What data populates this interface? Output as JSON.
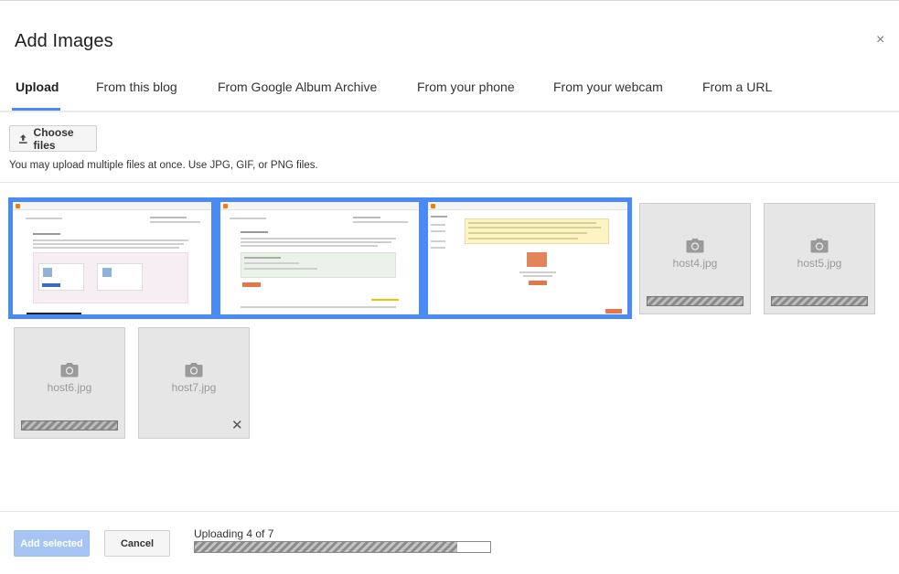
{
  "dialog": {
    "title": "Add Images",
    "close_glyph": "×"
  },
  "tabs": [
    {
      "label": "Upload",
      "active": true
    },
    {
      "label": "From this blog",
      "active": false
    },
    {
      "label": "From Google Album Archive",
      "active": false
    },
    {
      "label": "From your phone",
      "active": false
    },
    {
      "label": "From your webcam",
      "active": false
    },
    {
      "label": "From a URL",
      "active": false
    }
  ],
  "upload": {
    "choose_label": "Choose files",
    "choose_icon": "upload-icon",
    "hint": "You may upload multiple files at once. Use JPG, GIF, or PNG files."
  },
  "images": [
    {
      "state": "uploaded",
      "selected": true
    },
    {
      "state": "uploaded",
      "selected": true
    },
    {
      "state": "uploaded",
      "selected": true
    },
    {
      "state": "uploading",
      "filename": "host4.jpg",
      "icon": "camera-icon"
    },
    {
      "state": "uploading",
      "filename": "host5.jpg",
      "icon": "camera-icon"
    },
    {
      "state": "uploading",
      "filename": "host6.jpg",
      "icon": "camera-icon"
    },
    {
      "state": "queued",
      "filename": "host7.jpg",
      "icon": "camera-icon",
      "remove_glyph": "✕"
    }
  ],
  "footer": {
    "add_label": "Add selected",
    "cancel_label": "Cancel",
    "status": "Uploading 4 of 7",
    "progress": 0.89
  },
  "colors": {
    "accent": "#4a8af4",
    "add_disabled": "#a7c5f4"
  }
}
